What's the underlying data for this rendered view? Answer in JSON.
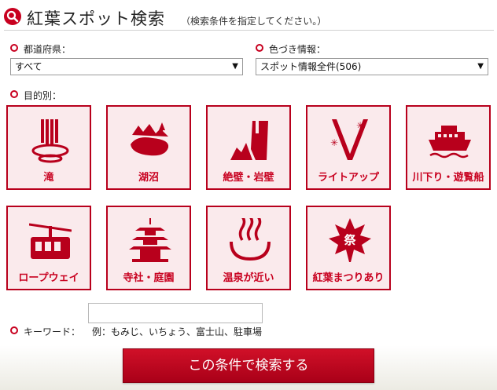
{
  "header": {
    "title": "紅葉スポット検索",
    "note": "（検索条件を指定してください。）",
    "icon": "search-icon"
  },
  "prefecture": {
    "label": "都道府県：",
    "selected": "すべて"
  },
  "color_info": {
    "label": "色づき情報：",
    "selected": "スポット情報全件(506)"
  },
  "purpose": {
    "label": "目的別：",
    "tiles": [
      {
        "label": "滝",
        "icon": "waterfall-icon"
      },
      {
        "label": "湖沼",
        "icon": "lake-icon"
      },
      {
        "label": "絶壁・岩壁",
        "icon": "cliff-icon"
      },
      {
        "label": "ライトアップ",
        "icon": "lightup-icon"
      },
      {
        "label": "川下り・遊覧船",
        "icon": "boat-icon"
      },
      {
        "label": "ロープウェイ",
        "icon": "ropeway-icon"
      },
      {
        "label": "寺社・庭園",
        "icon": "pagoda-icon"
      },
      {
        "label": "温泉が近い",
        "icon": "hot-spring-icon"
      },
      {
        "label": "紅葉まつりあり",
        "icon": "maple-festival-icon"
      }
    ],
    "festival_char": "祭"
  },
  "keyword": {
    "label": "キーワード：",
    "value": "",
    "example": "例：もみじ、いちょう、富士山、駐車場"
  },
  "search_button": "この条件で検索する",
  "colors": {
    "accent": "#c8001f",
    "tile_bg": "#faeaec"
  }
}
